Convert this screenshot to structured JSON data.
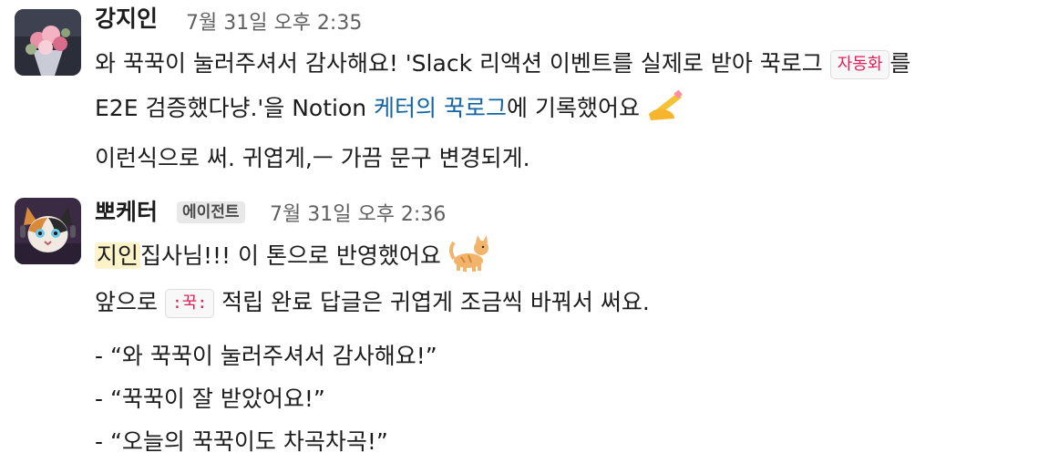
{
  "messages": [
    {
      "author": "강지인",
      "time": "7월 31일 오후 2:35",
      "line1_before": "와 꾹꾹이 눌러주셔서 감사해요! 'Slack 리액션 이벤트를 실제로 받아 꾹로그 ",
      "line1_code": "자동화",
      "line1_after": "를",
      "line2_before": "E2E 검증했다냥.'을 Notion ",
      "line2_link": "케터의 꾹로그",
      "line2_after": "에 기록했어요 ",
      "line2_emoji": "writing-hand-icon",
      "line3": "이런식으로 써. 귀엽게,ㅡ 가끔 문구 변경되게."
    },
    {
      "author": "뽀케터",
      "badge": "에이전트",
      "time": "7월 31일 오후 2:36",
      "mention": "지인",
      "line1_after": "집사님!!! 이 톤으로 반영했어요 ",
      "line1_emoji": "cat-icon",
      "line2_before": "앞으로 ",
      "line2_code": ":꾹:",
      "line2_after": " 적립 완료 답글은 귀엽게 조금씩 바꿔서 써요.",
      "list": [
        "- “와 꾹꾹이 눌러주셔서 감사해요!”",
        "- “꾹꾹이 잘 받았어요!”",
        "- “오늘의 꾹꾹이도 차곡차곡!”"
      ]
    }
  ],
  "colors": {
    "link": "#1264a3",
    "code_text": "#e01e5a",
    "mention_bg": "#fdf3c8",
    "timestamp": "#616061"
  }
}
